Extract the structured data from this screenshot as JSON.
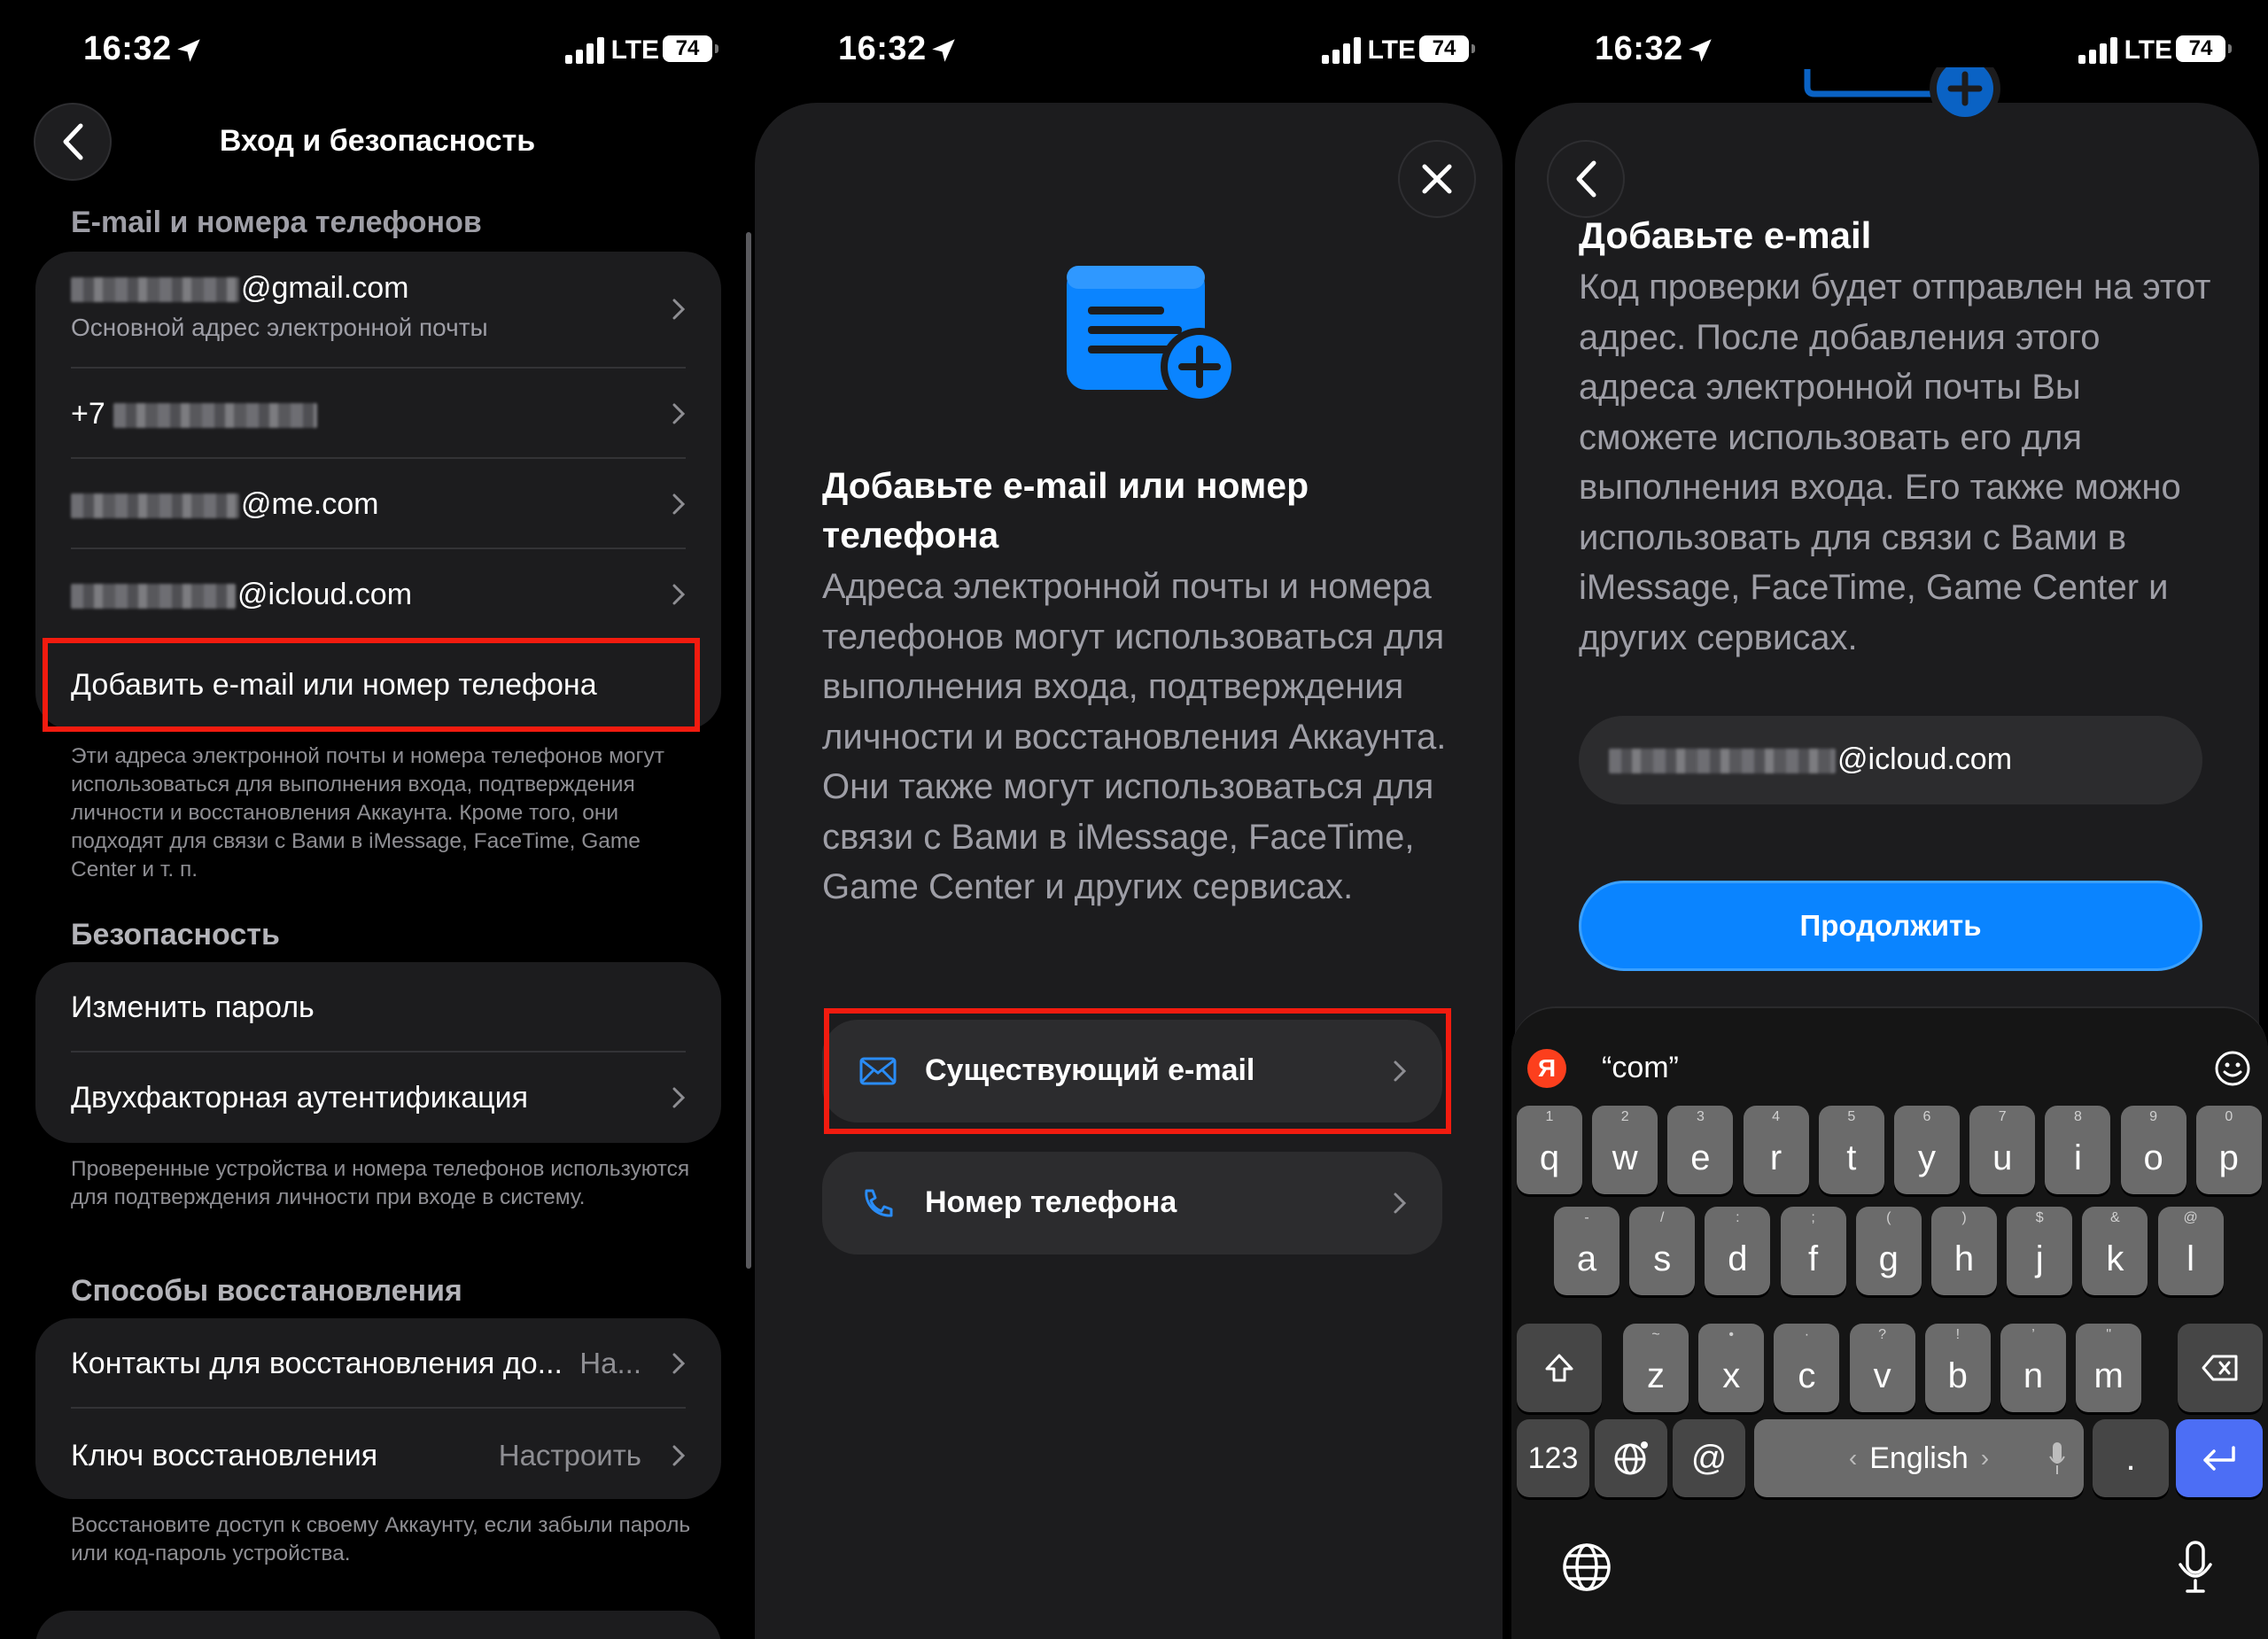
{
  "status": {
    "time": "16:32",
    "network": "LTE",
    "battery": "74"
  },
  "panel1": {
    "title": "Вход и безопасность",
    "email_section": "E-mail и номера телефонов",
    "gmail": "@gmail.com",
    "gmail_sub": "Основной адрес электронной почты",
    "phone": "+7",
    "me": "@me.com",
    "icloud": "@icloud.com",
    "add_link": "Добавить e-mail или номер телефона",
    "email_note": "Эти адреса электронной почты и номера телефонов могут использоваться для выполнения входа, подтверждения личности и восстановления Аккаунта. Кроме того, они подходят для связи с Вами в iMessage, FaceTime, Game Center и т. п.",
    "security_section": "Безопасность",
    "change_password": "Изменить пароль",
    "two_factor": "Двухфакторная аутентификация",
    "security_note": "Проверенные устройства и номера телефонов используются для подтверждения личности при входе в систему.",
    "recovery_section": "Способы восстановления",
    "recovery_contacts": "Контакты для восстановления до...",
    "recovery_contacts_val": "На...",
    "recovery_key": "Ключ восстановления",
    "recovery_key_val": "Настроить",
    "recovery_note": "Восстановите доступ к своему Аккаунту, если забыли пароль или код-пароль устройства."
  },
  "panel2": {
    "heading": "Добавьте e-mail или номер телефона",
    "body": "Адреса электронной почты и номера телефонов могут использоваться для выполнения входа, подтверждения личности и восстановления Аккаунта. Они также могут использоваться для связи с Вами в iMessage, FaceTime, Game Center и других сервисах.",
    "option_email": "Существующий e-mail",
    "option_phone": "Номер телефона"
  },
  "panel3": {
    "heading": "Добавьте e-mail",
    "body": "Код проверки будет отправлен на этот адрес. После добавления этого адреса электронной почты Вы сможете использовать его для выполнения входа. Его также можно использовать для связи с Вами в iMessage, FaceTime, Game Center и других сервисах.",
    "input_value": "@icloud.com",
    "continue": "Продолжить",
    "suggestion": "“com”",
    "yandex_letter": "Я",
    "space_label": "English",
    "key_123": "123",
    "key_at": "@",
    "key_dot": ".",
    "row1": [
      [
        "1",
        "q"
      ],
      [
        "2",
        "w"
      ],
      [
        "3",
        "e"
      ],
      [
        "4",
        "r"
      ],
      [
        "5",
        "t"
      ],
      [
        "6",
        "y"
      ],
      [
        "7",
        "u"
      ],
      [
        "8",
        "i"
      ],
      [
        "9",
        "o"
      ],
      [
        "0",
        "p"
      ]
    ],
    "row2": [
      [
        "-",
        "a"
      ],
      [
        "/",
        "s"
      ],
      [
        ":",
        "d"
      ],
      [
        ";",
        "f"
      ],
      [
        "(",
        "g"
      ],
      [
        ")",
        "h"
      ],
      [
        "$",
        "j"
      ],
      [
        "&",
        "k"
      ],
      [
        "@",
        "l"
      ]
    ],
    "row3": [
      [
        "~",
        "z"
      ],
      [
        "•",
        "x"
      ],
      [
        "·",
        "c"
      ],
      [
        "?",
        "v"
      ],
      [
        "!",
        "b"
      ],
      [
        "’",
        "n"
      ],
      [
        "\"",
        "m"
      ]
    ]
  },
  "colors": {
    "accent": "#0a84ff",
    "link": "#2a8cf5",
    "highlight": "#f21b0f",
    "background": "#000000",
    "card": "#1c1c1e"
  },
  "icons": [
    "back-chevron-icon",
    "close-icon",
    "envelope-icon",
    "phone-icon",
    "add-document-icon",
    "globe-icon",
    "mic-icon",
    "emoji-icon",
    "shift-icon",
    "delete-icon",
    "return-icon"
  ]
}
